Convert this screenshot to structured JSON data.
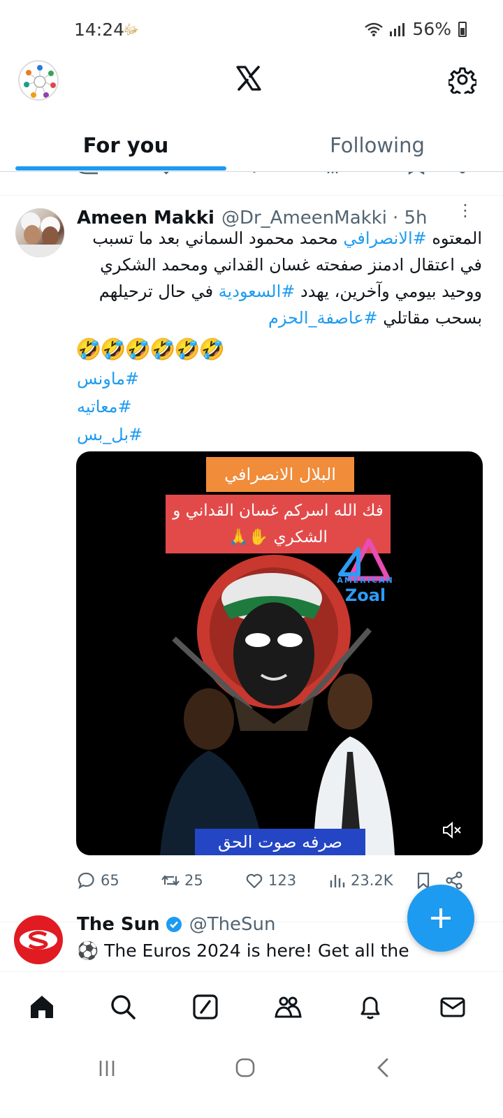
{
  "status_bar": {
    "time": "14:24",
    "extra_glyph": "ﷻ",
    "battery": "56%"
  },
  "tabs": [
    {
      "label": "For you",
      "active": true
    },
    {
      "label": "Following",
      "active": false
    }
  ],
  "tweet": {
    "name": "Ameen Makki",
    "handle": "@Dr_AmeenMakki",
    "time": "· 5h",
    "text_parts": {
      "p1": "المعتوه ",
      "tag1": "#الانصرافي",
      "p2": " محمد محمود السماني بعد ما تسبب في اعتقال ادمنز صفحته غسان القداني ومحمد الشكري ووحيد بيومي وآخرين، يهدد ",
      "tag2": "#السعودية",
      "p3": " في حال ترحيلهم بسحب مقاتلي ",
      "tag3": "#عاصفة_الحزم"
    },
    "emoji": "🤣🤣🤣🤣🤣🤣",
    "hashtags": [
      "ماونس#",
      "معاتيه#",
      "بل_بس#"
    ],
    "media": {
      "banner1": "البلال الانصرافي",
      "banner2": "فك الله اسركم غسان القداني و الشكري ✋🙏",
      "brand_small": "AMERICAN",
      "brand": "Zoal",
      "banner3": "صرفه  صوت  الحق"
    },
    "actions": {
      "replies": "65",
      "reposts": "25",
      "likes": "123",
      "views": "23.2K"
    }
  },
  "tweet2": {
    "name": "The Sun",
    "handle": "@TheSun",
    "text": "⚽ The Euros 2024 is here!  Get all the"
  },
  "colors": {
    "accent": "#1d9bf0",
    "text": "#0f1419",
    "muted": "#536471"
  }
}
